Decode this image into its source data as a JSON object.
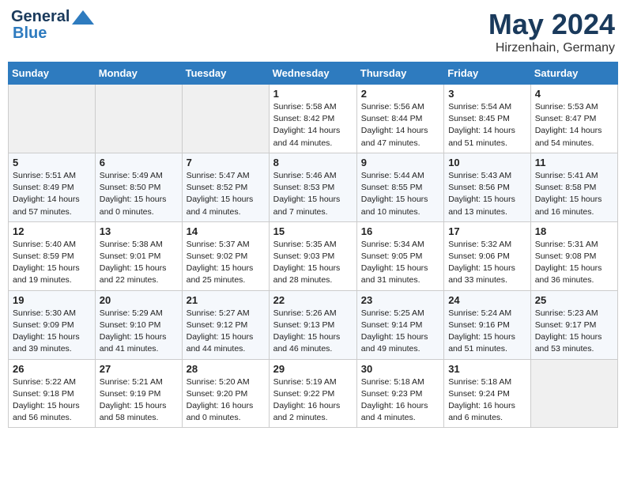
{
  "header": {
    "logo_line1": "General",
    "logo_line2": "Blue",
    "title": "May 2024",
    "subtitle": "Hirzenhain, Germany"
  },
  "weekdays": [
    "Sunday",
    "Monday",
    "Tuesday",
    "Wednesday",
    "Thursday",
    "Friday",
    "Saturday"
  ],
  "weeks": [
    [
      {
        "day": "",
        "info": ""
      },
      {
        "day": "",
        "info": ""
      },
      {
        "day": "",
        "info": ""
      },
      {
        "day": "1",
        "info": "Sunrise: 5:58 AM\nSunset: 8:42 PM\nDaylight: 14 hours\nand 44 minutes."
      },
      {
        "day": "2",
        "info": "Sunrise: 5:56 AM\nSunset: 8:44 PM\nDaylight: 14 hours\nand 47 minutes."
      },
      {
        "day": "3",
        "info": "Sunrise: 5:54 AM\nSunset: 8:45 PM\nDaylight: 14 hours\nand 51 minutes."
      },
      {
        "day": "4",
        "info": "Sunrise: 5:53 AM\nSunset: 8:47 PM\nDaylight: 14 hours\nand 54 minutes."
      }
    ],
    [
      {
        "day": "5",
        "info": "Sunrise: 5:51 AM\nSunset: 8:49 PM\nDaylight: 14 hours\nand 57 minutes."
      },
      {
        "day": "6",
        "info": "Sunrise: 5:49 AM\nSunset: 8:50 PM\nDaylight: 15 hours\nand 0 minutes."
      },
      {
        "day": "7",
        "info": "Sunrise: 5:47 AM\nSunset: 8:52 PM\nDaylight: 15 hours\nand 4 minutes."
      },
      {
        "day": "8",
        "info": "Sunrise: 5:46 AM\nSunset: 8:53 PM\nDaylight: 15 hours\nand 7 minutes."
      },
      {
        "day": "9",
        "info": "Sunrise: 5:44 AM\nSunset: 8:55 PM\nDaylight: 15 hours\nand 10 minutes."
      },
      {
        "day": "10",
        "info": "Sunrise: 5:43 AM\nSunset: 8:56 PM\nDaylight: 15 hours\nand 13 minutes."
      },
      {
        "day": "11",
        "info": "Sunrise: 5:41 AM\nSunset: 8:58 PM\nDaylight: 15 hours\nand 16 minutes."
      }
    ],
    [
      {
        "day": "12",
        "info": "Sunrise: 5:40 AM\nSunset: 8:59 PM\nDaylight: 15 hours\nand 19 minutes."
      },
      {
        "day": "13",
        "info": "Sunrise: 5:38 AM\nSunset: 9:01 PM\nDaylight: 15 hours\nand 22 minutes."
      },
      {
        "day": "14",
        "info": "Sunrise: 5:37 AM\nSunset: 9:02 PM\nDaylight: 15 hours\nand 25 minutes."
      },
      {
        "day": "15",
        "info": "Sunrise: 5:35 AM\nSunset: 9:03 PM\nDaylight: 15 hours\nand 28 minutes."
      },
      {
        "day": "16",
        "info": "Sunrise: 5:34 AM\nSunset: 9:05 PM\nDaylight: 15 hours\nand 31 minutes."
      },
      {
        "day": "17",
        "info": "Sunrise: 5:32 AM\nSunset: 9:06 PM\nDaylight: 15 hours\nand 33 minutes."
      },
      {
        "day": "18",
        "info": "Sunrise: 5:31 AM\nSunset: 9:08 PM\nDaylight: 15 hours\nand 36 minutes."
      }
    ],
    [
      {
        "day": "19",
        "info": "Sunrise: 5:30 AM\nSunset: 9:09 PM\nDaylight: 15 hours\nand 39 minutes."
      },
      {
        "day": "20",
        "info": "Sunrise: 5:29 AM\nSunset: 9:10 PM\nDaylight: 15 hours\nand 41 minutes."
      },
      {
        "day": "21",
        "info": "Sunrise: 5:27 AM\nSunset: 9:12 PM\nDaylight: 15 hours\nand 44 minutes."
      },
      {
        "day": "22",
        "info": "Sunrise: 5:26 AM\nSunset: 9:13 PM\nDaylight: 15 hours\nand 46 minutes."
      },
      {
        "day": "23",
        "info": "Sunrise: 5:25 AM\nSunset: 9:14 PM\nDaylight: 15 hours\nand 49 minutes."
      },
      {
        "day": "24",
        "info": "Sunrise: 5:24 AM\nSunset: 9:16 PM\nDaylight: 15 hours\nand 51 minutes."
      },
      {
        "day": "25",
        "info": "Sunrise: 5:23 AM\nSunset: 9:17 PM\nDaylight: 15 hours\nand 53 minutes."
      }
    ],
    [
      {
        "day": "26",
        "info": "Sunrise: 5:22 AM\nSunset: 9:18 PM\nDaylight: 15 hours\nand 56 minutes."
      },
      {
        "day": "27",
        "info": "Sunrise: 5:21 AM\nSunset: 9:19 PM\nDaylight: 15 hours\nand 58 minutes."
      },
      {
        "day": "28",
        "info": "Sunrise: 5:20 AM\nSunset: 9:20 PM\nDaylight: 16 hours\nand 0 minutes."
      },
      {
        "day": "29",
        "info": "Sunrise: 5:19 AM\nSunset: 9:22 PM\nDaylight: 16 hours\nand 2 minutes."
      },
      {
        "day": "30",
        "info": "Sunrise: 5:18 AM\nSunset: 9:23 PM\nDaylight: 16 hours\nand 4 minutes."
      },
      {
        "day": "31",
        "info": "Sunrise: 5:18 AM\nSunset: 9:24 PM\nDaylight: 16 hours\nand 6 minutes."
      },
      {
        "day": "",
        "info": ""
      }
    ]
  ]
}
